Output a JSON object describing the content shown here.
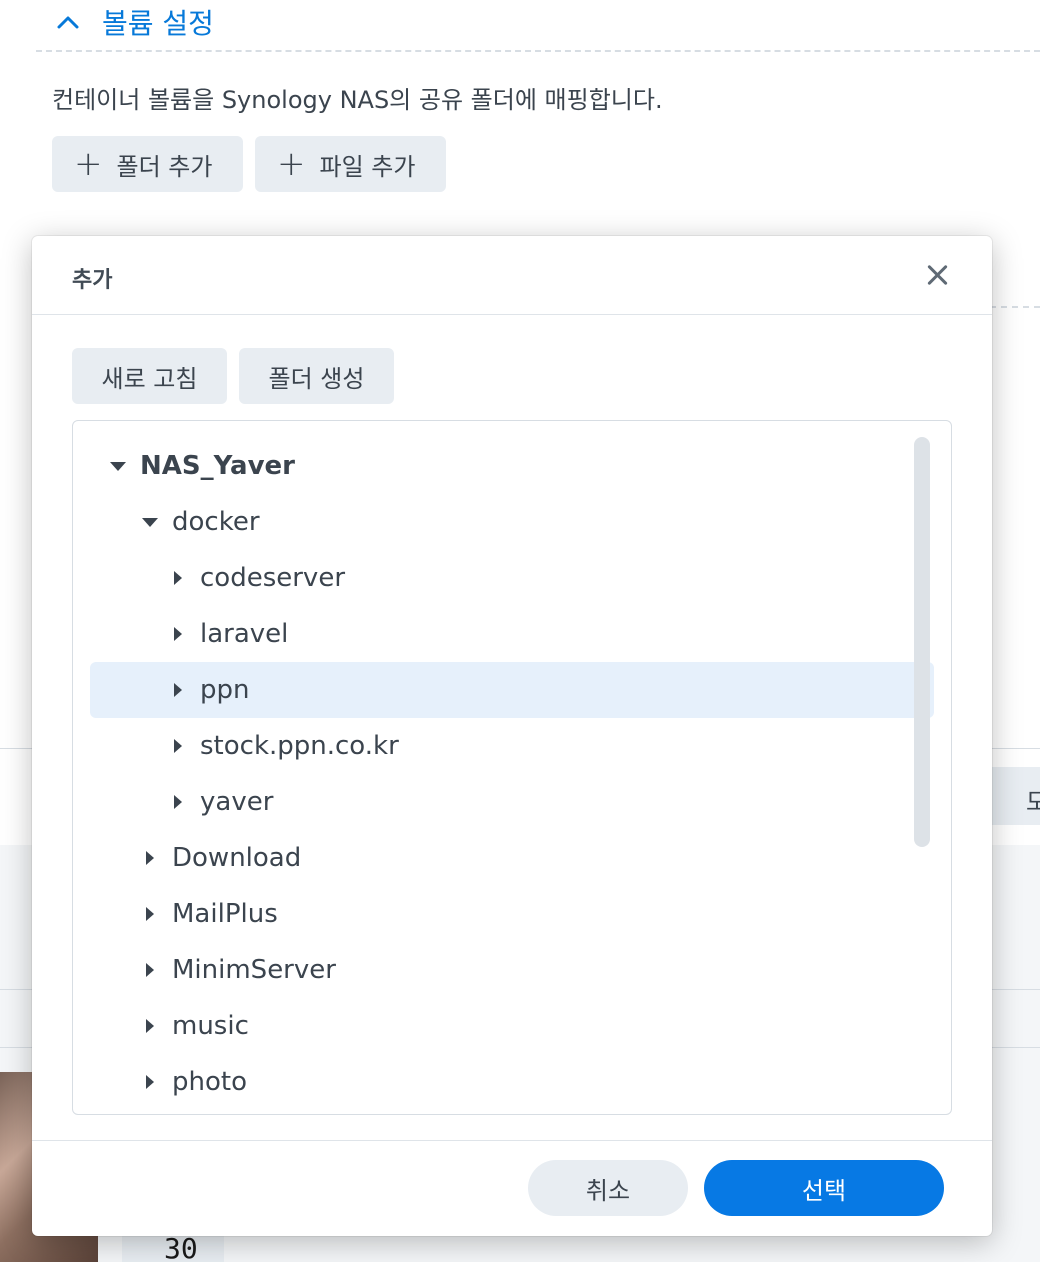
{
  "background": {
    "section_title": "볼륨 설정",
    "description": "컨테이너 볼륨을 Synology NAS의 공유 폴더에 매핑합니다.",
    "add_folder_label": "폴더 추가",
    "add_file_label": "파일 추가",
    "partial_char": "모",
    "number_value": "30"
  },
  "dialog": {
    "title": "추가",
    "refresh_label": "새로 고침",
    "create_folder_label": "폴더 생성",
    "tree": [
      {
        "label": "NAS_Yaver",
        "level": 0,
        "expanded": true,
        "bold": true
      },
      {
        "label": "docker",
        "level": 1,
        "expanded": true
      },
      {
        "label": "codeserver",
        "level": 2,
        "expanded": false
      },
      {
        "label": "laravel",
        "level": 2,
        "expanded": false
      },
      {
        "label": "ppn",
        "level": 2,
        "expanded": false,
        "selected": true
      },
      {
        "label": "stock.ppn.co.kr",
        "level": 2,
        "expanded": false
      },
      {
        "label": "yaver",
        "level": 2,
        "expanded": false
      },
      {
        "label": "Download",
        "level": 1,
        "expanded": false
      },
      {
        "label": "MailPlus",
        "level": 1,
        "expanded": false
      },
      {
        "label": "MinimServer",
        "level": 1,
        "expanded": false
      },
      {
        "label": "music",
        "level": 1,
        "expanded": false
      },
      {
        "label": "photo",
        "level": 1,
        "expanded": false
      }
    ],
    "cancel_label": "취소",
    "select_label": "선택"
  },
  "colors": {
    "accent": "#0779e4",
    "header_blue": "#0779d9",
    "selected_row": "#e6f0fb",
    "button_gray": "#e8edf2"
  }
}
